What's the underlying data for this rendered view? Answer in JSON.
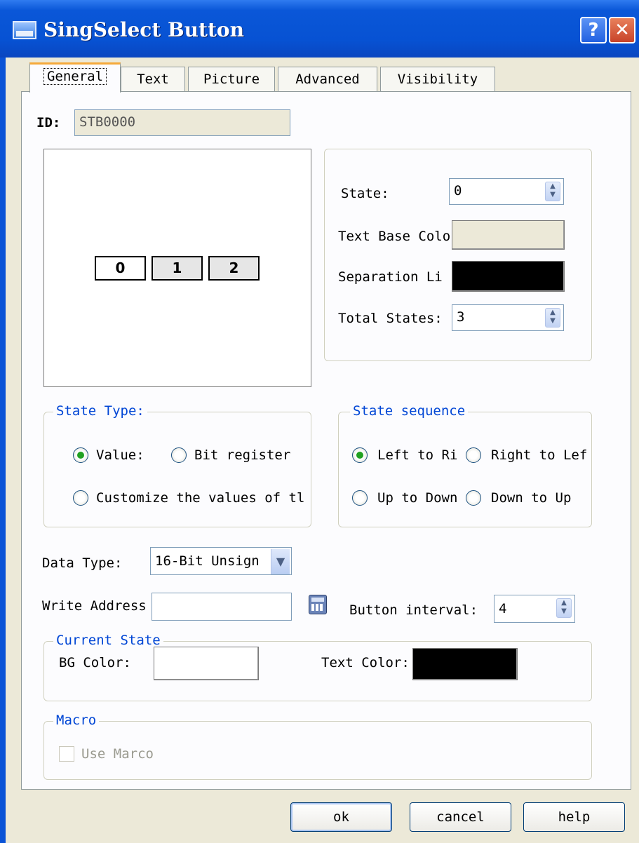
{
  "window": {
    "title": "SingSelect Button",
    "help_label": "?",
    "close_label": "✕"
  },
  "tabs": [
    "General",
    "Text",
    "Picture",
    "Advanced",
    "Visibility"
  ],
  "active_tab": "General",
  "id_field": {
    "label": "ID:",
    "value": "STB0000"
  },
  "preview": {
    "states": [
      "0",
      "1",
      "2"
    ]
  },
  "state_panel": {
    "state_label": "State:",
    "state_value": "0",
    "text_base_color_label": "Text Base Colo",
    "text_base_color": "#ece9d8",
    "separation_line_label": "Separation Li",
    "separation_line_color": "#000000",
    "total_states_label": "Total States:",
    "total_states_value": "3"
  },
  "state_type": {
    "legend": "State Type:",
    "value_label": "Value:",
    "bit_register_label": "Bit register",
    "customize_label": "Customize the values of tl",
    "selected": "value"
  },
  "state_sequence": {
    "legend": "State sequence",
    "left_to_right_label": "Left to Ri",
    "right_to_left_label": "Right to Lef",
    "up_to_down_label": "Up to Down",
    "down_to_up_label": "Down to Up",
    "selected": "left_to_right"
  },
  "data_type": {
    "label": "Data Type:",
    "value": "16-Bit Unsign"
  },
  "write_address": {
    "label": "Write Address",
    "value": ""
  },
  "button_interval": {
    "label": "Button interval:",
    "value": "4"
  },
  "current_state": {
    "legend": "Current State",
    "bg_color_label": "BG Color:",
    "bg_color": "#ffffff",
    "text_color_label": "Text Color:",
    "text_color": "#000000"
  },
  "macro": {
    "legend": "Macro",
    "use_macro_label": "Use Marco",
    "checked": false
  },
  "buttons": {
    "ok": "ok",
    "cancel": "cancel",
    "help": "help"
  }
}
